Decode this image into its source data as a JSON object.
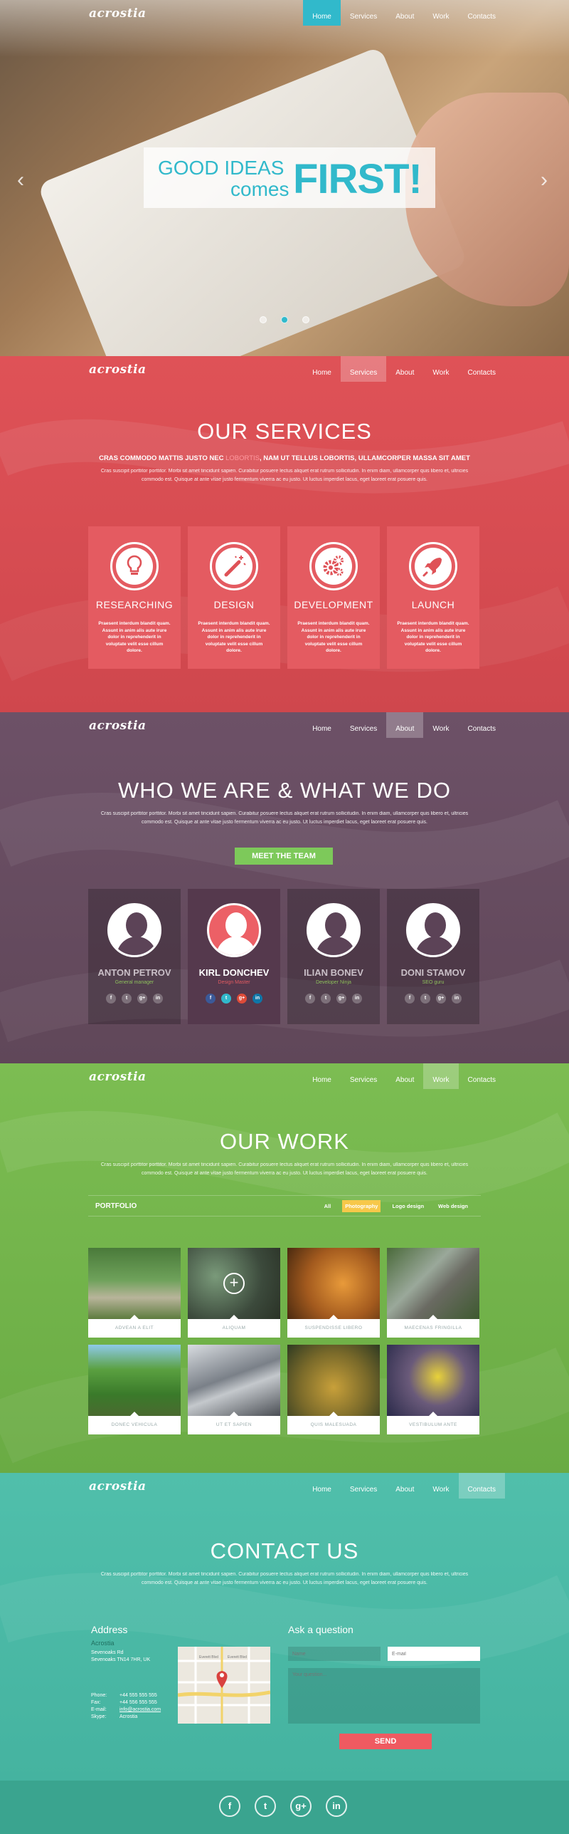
{
  "brand": {
    "logo": "acrostia",
    "colors": {
      "teal": "#31b9cb",
      "red": "#df5257",
      "purple": "#6d5167",
      "green": "#7cbd52",
      "contact": "#50bfab",
      "yellow": "#f7c84a"
    }
  },
  "nav": {
    "home": "Home",
    "services": "Services",
    "about": "About",
    "work": "Work",
    "contacts": "Contacts"
  },
  "hero": {
    "line1": "GOOD IDEAS",
    "line2": "comes",
    "line3": "FIRST!",
    "prev_icon": "chevron-left-icon",
    "next_icon": "chevron-right-icon"
  },
  "services": {
    "title": "OUR SERVICES",
    "lead_a": "CRAS COMMODO MATTIS JUSTO NEC ",
    "lead_b": "LOBORTIS",
    "lead_c": ", NAM UT TELLUS LOBORTIS, ULLAMCORPER MASSA SIT AMET",
    "text": "Cras suscipit porttitor porttitor. Morbi sit amet tincidunt sapien. Curabitur posuere lectus aliquet erat rutrum sollicitudin. In enim diam, ullamcorper quis libero et, ultricies commodo est. Quisque at ante vitae justo fermentum viverra ac eu justo. Ut luctus imperdiet lacus, eget laoreet erat posuere quis.",
    "cards": [
      {
        "title": "RESEARCHING",
        "icon": "lightbulb-icon",
        "text": "Praesent interdum blandit quam. Assunt in anim alis aute irure dolor in reprehenderit in voluptate velit esse cillum dolore."
      },
      {
        "title": "DESIGN",
        "icon": "magic-wand-icon",
        "text": "Praesent interdum blandit quam. Assunt in anim alis aute irure dolor in reprehenderit in voluptate velit esse cillum dolore."
      },
      {
        "title": "DEVELOPMENT",
        "icon": "gears-icon",
        "text": "Praesent interdum blandit quam. Assunt in anim alis aute irure dolor in reprehenderit in voluptate velit esse cillum dolore."
      },
      {
        "title": "LAUNCH",
        "icon": "rocket-icon",
        "text": "Praesent interdum blandit quam. Assunt in anim alis aute irure dolor in reprehenderit in voluptate velit esse cillum dolore."
      }
    ]
  },
  "about": {
    "title": "WHO WE ARE & WHAT WE DO",
    "text": "Cras suscipit porttitor porttitor. Morbi sit amet tincidunt sapien. Curabitur posuere lectus aliquet erat rutrum sollicitudin. In enim diam, ullamcorper quis libero et, ultricies commodo est. Quisque at ante vitae justo fermentum viverra ac eu justo. Ut luctus imperdiet lacus, eget laoreet erat posuere quis.",
    "button": "MEET THE TEAM",
    "team": [
      {
        "name": "ANTON PETROV",
        "role": "General manager"
      },
      {
        "name": "KIRL DONCHEV",
        "role": "Design Master"
      },
      {
        "name": "ILIAN BONEV",
        "role": "Developer Ninja"
      },
      {
        "name": "DONI STAMOV",
        "role": "SEO guru"
      }
    ],
    "social": {
      "f": "f",
      "t": "t",
      "g": "g+",
      "in": "in"
    }
  },
  "work": {
    "title": "OUR WORK",
    "text": "Cras suscipit porttitor porttitor. Morbi sit amet tincidunt sapien. Curabitur posuere lectus aliquet erat rutrum sollicitudin. In enim diam, ullamcorper quis libero et, ultricies commodo est. Quisque at ante vitae justo fermentum viverra ac eu justo. Ut luctus imperdiet lacus, eget laoreet erat posuere quis.",
    "portfolio": "PORTFOLIO",
    "filters": [
      "All",
      "Photography",
      "Logo design",
      "Web design"
    ],
    "items": [
      "ADVEAN A ELIT",
      "ALIQUAM",
      "SUSPENDISSE LIBERO",
      "MAECENAS FRINGILLA",
      "DONEC VEHICULA",
      "UT ET SAPIEN",
      "QUIS MALESUADA",
      "VESTIBULUM ANTE"
    ]
  },
  "contact": {
    "title": "CONTACT US",
    "text": "Cras suscipit porttitor porttitor. Morbi sit amet tincidunt sapien. Curabitur posuere lectus aliquet erat rutrum sollicitudin. In enim diam, ullamcorper quis libero et, ultricies commodo est. Quisque at ante vitae justo fermentum viverra ac eu justo. Ut luctus imperdiet lacus, eget laoreet erat posuere quis.",
    "address_h": "Address",
    "company": "Acrostia",
    "street1": "Sevenoaks Rd",
    "street2": "Sevenoaks TN14 7HR, UK",
    "phone_l": "Phone:",
    "phone": "+44 555 555 555",
    "fax_l": "Fax:",
    "fax": "+44 556 555 555",
    "email_l": "E-mail:",
    "email": "info@acrostia.com",
    "skype_l": "Skype:",
    "skype": "Acrostia",
    "map": {
      "road1": "Everett Blvd",
      "road2": "Everett Blvd"
    },
    "ask_h": "Ask a question",
    "name_ph": "Name",
    "email_ph": "E-mail",
    "question_ph": "Your question...",
    "send": "SEND"
  },
  "footer": {
    "f": "f",
    "t": "t",
    "g": "g+",
    "in": "in"
  }
}
